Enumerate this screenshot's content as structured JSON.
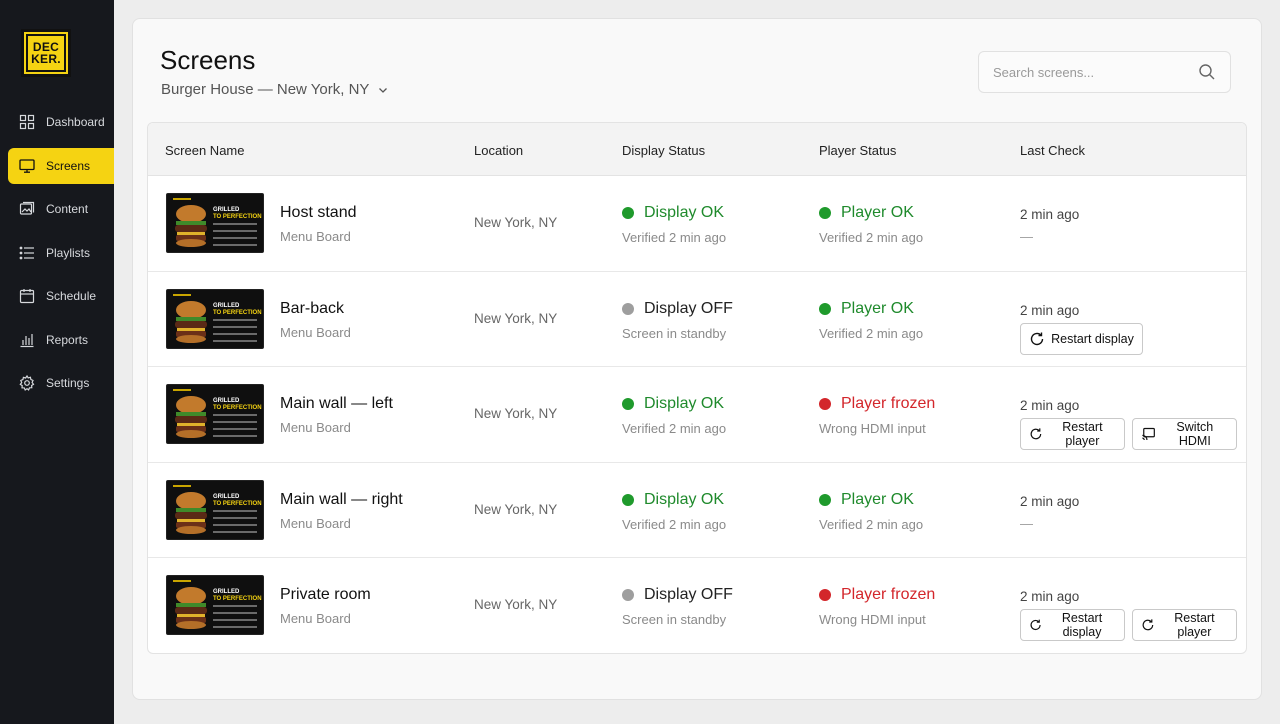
{
  "brand": {
    "logo_line1": "DEC",
    "logo_line2": "KER."
  },
  "nav": {
    "items": [
      {
        "label": "Dashboard",
        "icon": "dashboard-icon"
      },
      {
        "label": "Screens",
        "icon": "monitor-icon",
        "active": true
      },
      {
        "label": "Content",
        "icon": "content-icon"
      },
      {
        "label": "Playlists",
        "icon": "list-icon"
      },
      {
        "label": "Schedule",
        "icon": "calendar-icon"
      },
      {
        "label": "Reports",
        "icon": "bar-chart-icon"
      },
      {
        "label": "Settings",
        "icon": "gear-icon"
      }
    ]
  },
  "header": {
    "title": "Screens",
    "location": "Burger House — New York, NY",
    "search_placeholder": "Search screens..."
  },
  "table": {
    "columns": [
      "Screen Name",
      "Location",
      "Display Status",
      "Player Status",
      "Last Check"
    ],
    "rows": [
      {
        "name": "Host stand",
        "type": "Menu Board",
        "location": "New York, NY",
        "display_status": "Display OK",
        "display_sub": "Verified 2 min ago",
        "display_state": "ok",
        "player_status": "Player OK",
        "player_sub": "Verified 2 min ago",
        "player_state": "ok",
        "last_check": "2 min ago",
        "last_sub": "—",
        "actions": []
      },
      {
        "name": "Bar-back",
        "type": "Menu Board",
        "location": "New York, NY",
        "display_status": "Display OFF",
        "display_sub": "Screen in standby",
        "display_state": "off",
        "player_status": "Player OK",
        "player_sub": "Verified 2 min ago",
        "player_state": "ok",
        "last_check": "2 min ago",
        "last_sub": "",
        "actions": [
          "Restart display"
        ]
      },
      {
        "name": "Main wall — left",
        "type": "Menu Board",
        "location": "New York, NY",
        "display_status": "Display OK",
        "display_sub": "Verified 2 min ago",
        "display_state": "ok",
        "player_status": "Player frozen",
        "player_sub": "Wrong HDMI input",
        "player_state": "frozen",
        "last_check": "2 min ago",
        "last_sub": "",
        "actions": [
          "Restart player",
          "Switch HDMI"
        ]
      },
      {
        "name": "Main wall — right",
        "type": "Menu Board",
        "location": "New York, NY",
        "display_status": "Display OK",
        "display_sub": "Verified 2 min ago",
        "display_state": "ok",
        "player_status": "Player OK",
        "player_sub": "Verified 2 min ago",
        "player_state": "ok",
        "last_check": "2 min ago",
        "last_sub": "—",
        "actions": []
      },
      {
        "name": "Private room",
        "type": "Menu Board",
        "location": "New York, NY",
        "display_status": "Display OFF",
        "display_sub": "Screen in standby",
        "display_state": "off",
        "player_status": "Player frozen",
        "player_sub": "Wrong HDMI input",
        "player_state": "frozen",
        "last_check": "2 min ago",
        "last_sub": "",
        "actions": [
          "Restart display",
          "Restart player"
        ]
      }
    ]
  },
  "thumbnail": {
    "title_line1": "GRILLED",
    "title_line2": "TO PERFECTION"
  },
  "colors": {
    "accent": "#f5d312",
    "ok": "#1f8a2c",
    "frozen": "#d3262b",
    "off": "#9e9e9e",
    "sidebar": "#16181d"
  }
}
